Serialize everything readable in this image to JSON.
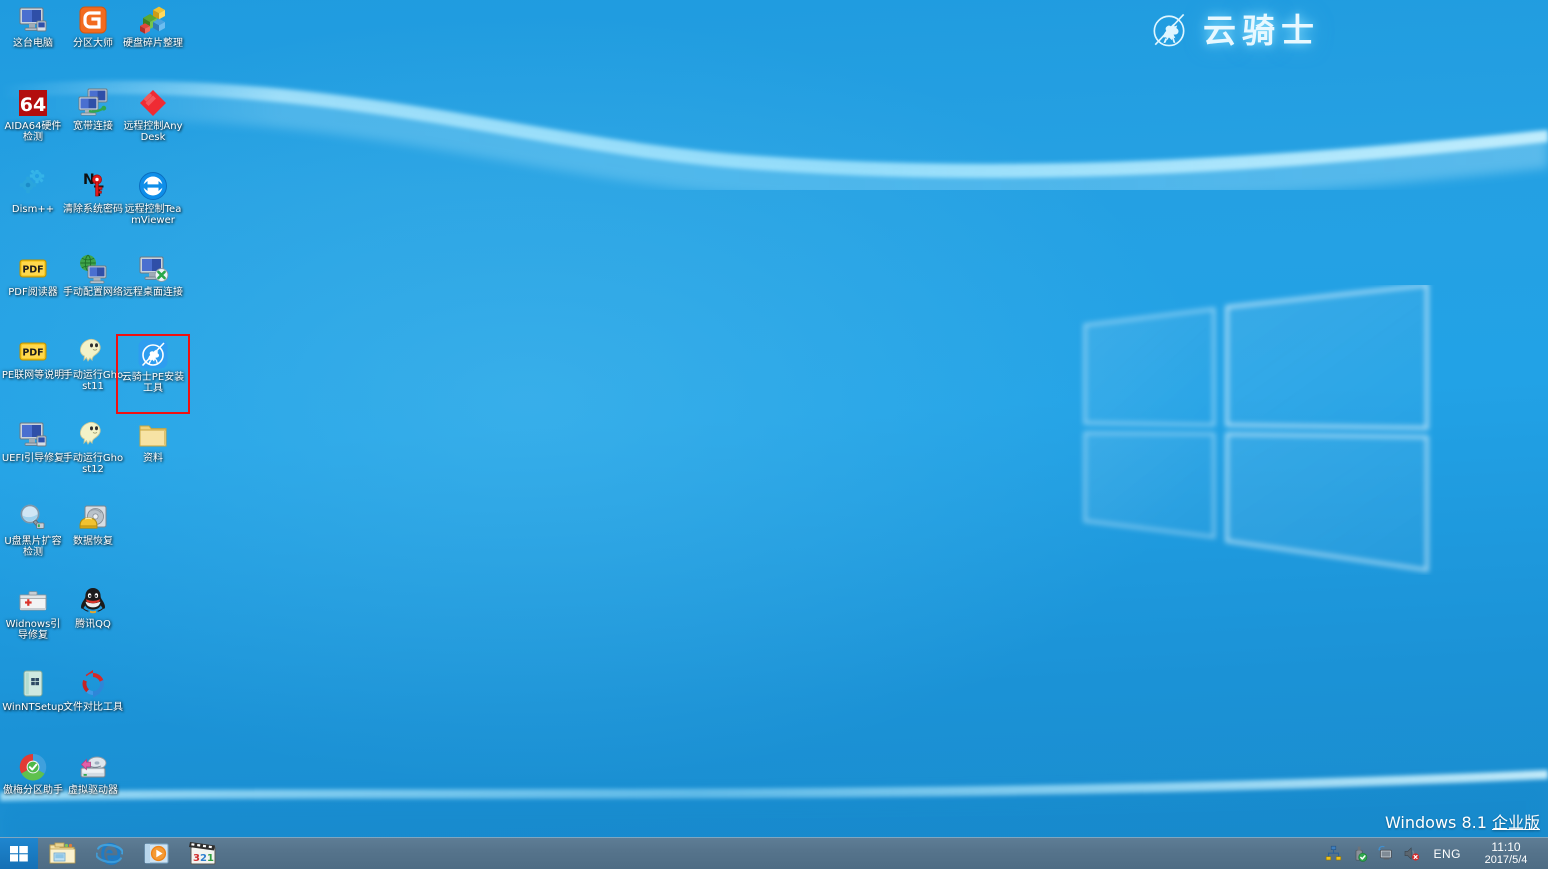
{
  "os": {
    "watermark_product": "Windows 8.1 ",
    "watermark_edition": "企业版"
  },
  "brand": {
    "name": "云骑士",
    "mark_icon": "knight-horse-circle-icon"
  },
  "desktop": {
    "icons": [
      {
        "label": "这台电脑",
        "icon": "this-pc-icon",
        "col": 0,
        "row": 0,
        "selected": false
      },
      {
        "label": "分区大师",
        "icon": "partition-master-icon",
        "col": 1,
        "row": 0,
        "selected": false
      },
      {
        "label": "硬盘碎片整理",
        "icon": "disk-defrag-icon",
        "col": 2,
        "row": 0,
        "selected": false
      },
      {
        "label": "AIDA64硬件检测",
        "icon": "aida64-icon",
        "col": 0,
        "row": 1,
        "selected": false
      },
      {
        "label": "宽带连接",
        "icon": "broadband-connection-icon",
        "col": 1,
        "row": 1,
        "selected": false
      },
      {
        "label": "远程控制AnyDesk",
        "icon": "anydesk-icon",
        "col": 2,
        "row": 1,
        "selected": false
      },
      {
        "label": "Dism++",
        "icon": "dism-plus-plus-icon",
        "col": 0,
        "row": 2,
        "selected": false
      },
      {
        "label": "清除系统密码",
        "icon": "clear-password-icon",
        "col": 1,
        "row": 2,
        "selected": false
      },
      {
        "label": "远程控制TeamViewer",
        "icon": "teamviewer-icon",
        "col": 2,
        "row": 2,
        "selected": false
      },
      {
        "label": "PDF阅读器",
        "icon": "pdf-reader-icon",
        "col": 0,
        "row": 3,
        "selected": false
      },
      {
        "label": "手动配置网络",
        "icon": "configure-network-icon",
        "col": 1,
        "row": 3,
        "selected": false
      },
      {
        "label": "远程桌面连接",
        "icon": "remote-desktop-icon",
        "col": 2,
        "row": 3,
        "selected": false
      },
      {
        "label": "PE联网等说明",
        "icon": "pdf-reader-icon",
        "col": 0,
        "row": 4,
        "selected": false
      },
      {
        "label": "手动运行Ghost11",
        "icon": "ghost11-icon",
        "col": 1,
        "row": 4,
        "selected": false
      },
      {
        "label": "云骑士PE安装工具",
        "icon": "yunqishi-pe-installer-icon",
        "col": 2,
        "row": 4,
        "selected": true
      },
      {
        "label": "UEFI引导修复",
        "icon": "uefi-boot-repair-icon",
        "col": 0,
        "row": 5,
        "selected": false
      },
      {
        "label": "手动运行Ghost12",
        "icon": "ghost12-icon",
        "col": 1,
        "row": 5,
        "selected": false
      },
      {
        "label": "资料",
        "icon": "folder-icon",
        "col": 2,
        "row": 5,
        "selected": false
      },
      {
        "label": "U盘黑片扩容检测",
        "icon": "usb-capacity-test-icon",
        "col": 0,
        "row": 6,
        "selected": false
      },
      {
        "label": "数据恢复",
        "icon": "data-recovery-icon",
        "col": 1,
        "row": 6,
        "selected": false
      },
      {
        "label": "Widnows引导修复",
        "icon": "windows-boot-repair-icon",
        "col": 0,
        "row": 7,
        "selected": false
      },
      {
        "label": "腾讯QQ",
        "icon": "tencent-qq-icon",
        "col": 1,
        "row": 7,
        "selected": false
      },
      {
        "label": "WinNTSetup",
        "icon": "winntsetup-icon",
        "col": 0,
        "row": 8,
        "selected": false
      },
      {
        "label": "文件对比工具",
        "icon": "file-compare-icon",
        "col": 1,
        "row": 8,
        "selected": false
      },
      {
        "label": "傲梅分区助手",
        "icon": "aomei-partition-assistant-icon",
        "col": 0,
        "row": 9,
        "selected": false
      },
      {
        "label": "虚拟驱动器",
        "icon": "virtual-drive-icon",
        "col": 1,
        "row": 9,
        "selected": false
      }
    ]
  },
  "taskbar": {
    "start_label": "start-button",
    "quick_launch": [
      {
        "name": "file-explorer-icon",
        "title": "文件资源管理器"
      },
      {
        "name": "internet-explorer-icon",
        "title": "Internet Explorer"
      },
      {
        "name": "media-player-icon",
        "title": "Windows Media Player"
      },
      {
        "name": "media-player-classic-icon",
        "title": "Media Player Classic",
        "badge": "321"
      }
    ],
    "tray": [
      {
        "name": "network-share-icon"
      },
      {
        "name": "usb-safely-remove-icon"
      },
      {
        "name": "network-connection-icon"
      },
      {
        "name": "speaker-muted-icon"
      }
    ],
    "language": "ENG",
    "clock_time": "11:10",
    "clock_date": "2017/5/4"
  },
  "colors": {
    "desktop_blue": "#22a0e4",
    "taskbar": "#56748c",
    "start_blue": "#1a7cc4",
    "selection_red": "#ee1111",
    "brand_glow": "#e8f8ff"
  }
}
